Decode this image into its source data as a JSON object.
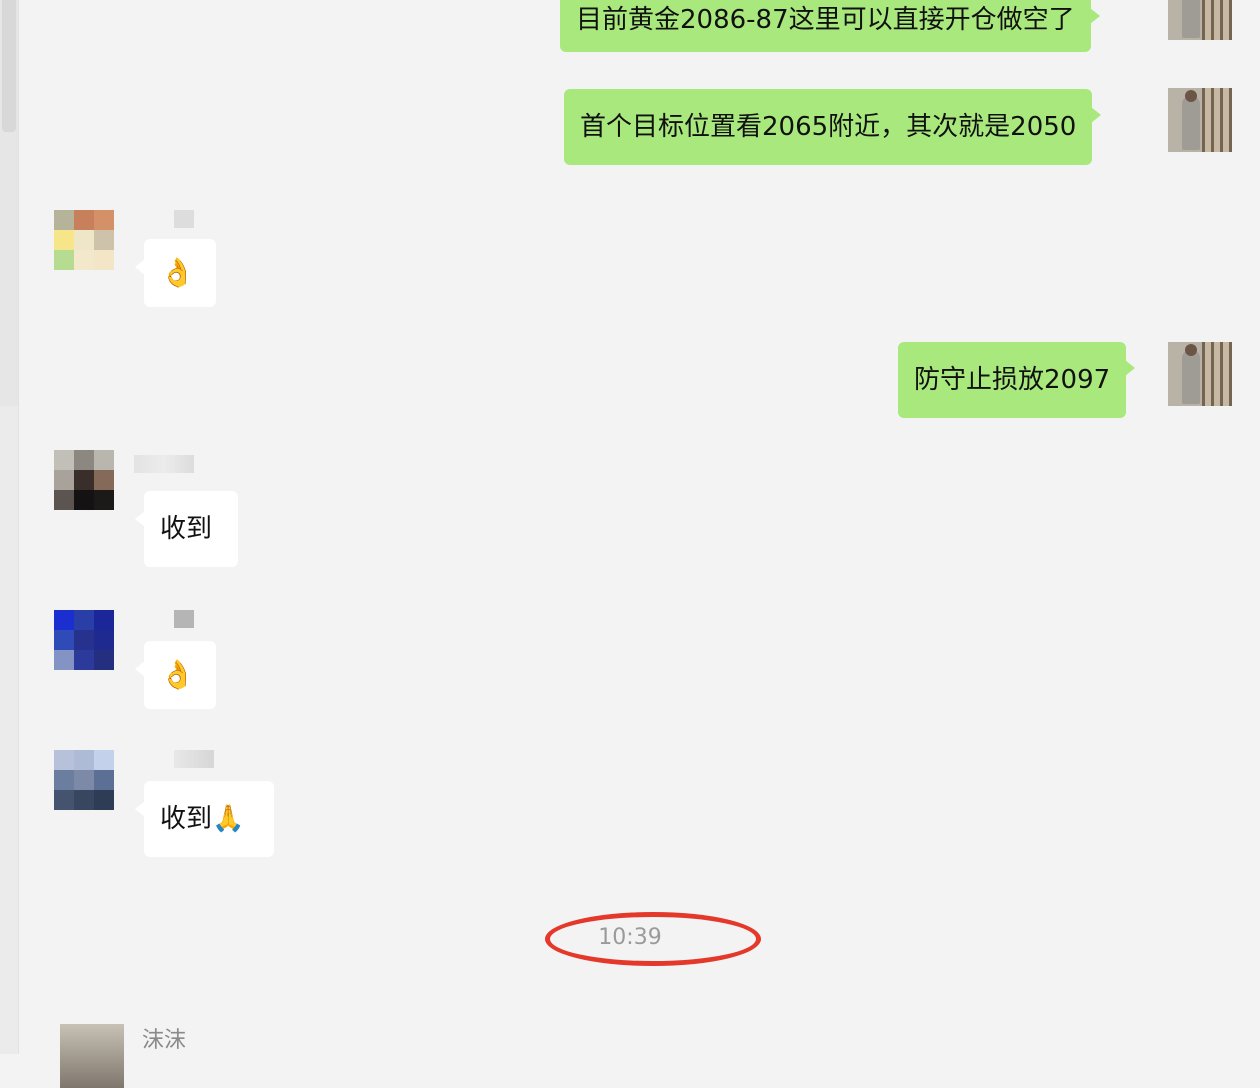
{
  "chat": {
    "messages": [
      {
        "from": "me",
        "text": "目前黄金2086-87这里可以直接开仓做空了"
      },
      {
        "from": "me",
        "text": "首个目标位置看2065附近，其次就是2050"
      },
      {
        "from": "other",
        "text": "👌"
      },
      {
        "from": "me",
        "text": "防守止损放2097"
      },
      {
        "from": "other",
        "text": "收到"
      },
      {
        "from": "other",
        "text": "👌"
      },
      {
        "from": "other",
        "text": "收到🙏"
      }
    ],
    "timestamp": "10:39",
    "next_sender": "沫沫"
  },
  "colors": {
    "my_bubble": "#a9e87c",
    "their_bubble": "#ffffff",
    "highlight_circle": "#e4382a",
    "background": "#f3f3f3"
  },
  "icons": {
    "ok_hand": "ok-hand-emoji",
    "folded_hands": "folded-hands-emoji"
  }
}
